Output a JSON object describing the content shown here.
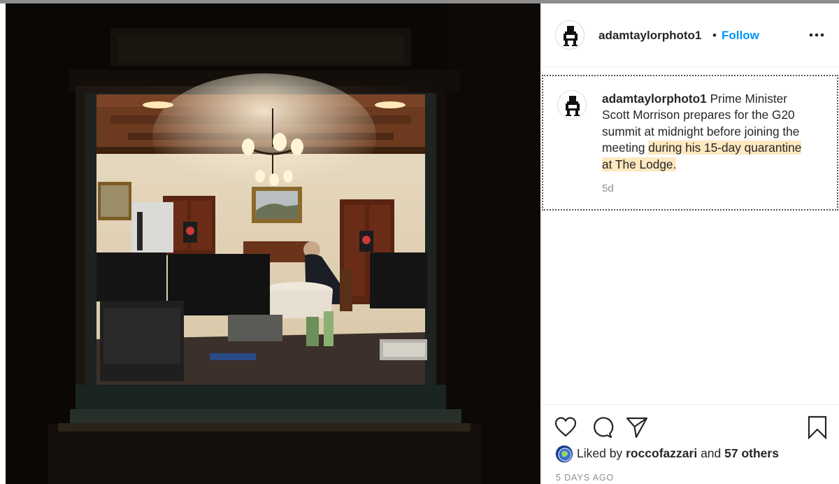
{
  "post": {
    "username": "adamtaylorphoto1",
    "separator": "•",
    "follow_label": "Follow",
    "more_label": "More options"
  },
  "caption": {
    "username": "adamtaylorphoto1",
    "text_plain": "Prime Minister Scott Morrison prepares for the G20 summit at midnight before joining the meeting",
    "text_highlighted": "during his 15-day quarantine at The Lodge.",
    "highlight_color": "#fde8c0",
    "time": "5d"
  },
  "actions": {
    "icons": [
      "heart-icon",
      "comment-icon",
      "paper-plane-icon",
      "bookmark-icon"
    ]
  },
  "likes": {
    "prefix": "Liked by",
    "liker": "roccofazzari",
    "joiner": "and",
    "others": "57 others"
  },
  "date": "5 DAYS AGO",
  "colors": {
    "link_blue": "#0095f6",
    "text_primary": "#262626",
    "text_secondary": "#8e8e8e"
  }
}
